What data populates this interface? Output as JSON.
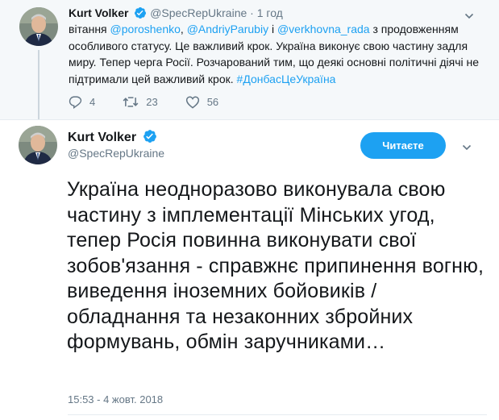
{
  "reply_tweet": {
    "author_name": "Kurt Volker",
    "handle": "@SpecRepUkraine",
    "separator": "·",
    "time": "1 год",
    "body": {
      "t1": "вітання ",
      "m1": "@poroshenko",
      "t2": ", ",
      "m2": "@AndriyParubiy",
      "t3": " і ",
      "m3": "@verkhovna_rada",
      "t4": " з продовженням особливого статусу. Це важливий крок. Україна виконує свою частину задля миру. Тепер черга Росії. Розчарований тим, що деякі основні політичні діячі не підтримали цей важливий крок. ",
      "hashtag": "#ДонбасЦеУкраїна"
    },
    "actions": {
      "replies": "4",
      "retweets": "23",
      "likes": "56"
    }
  },
  "main_tweet": {
    "author_name": "Kurt Volker",
    "handle": "@SpecRepUkraine",
    "follow_label": "Читаєте",
    "text": "Україна неодноразово виконувала свою частину з імплементації Мінських угод, тепер Росія повинна виконувати свої зобов'язання - справжнє припинення вогню, виведення іноземних бойовиків / обладнання та незаконних збройних формувань, обмін заручниками…",
    "timestamp": "15:53 - 4 жовт. 2018"
  },
  "colors": {
    "accent": "#1da1f2",
    "text": "#14171a",
    "muted": "#657786",
    "reply_background": "#f5f8fa"
  },
  "icons": [
    "verified-badge-icon",
    "chevron-down-icon",
    "reply-icon",
    "retweet-icon",
    "like-icon",
    "avatar-photo"
  ]
}
